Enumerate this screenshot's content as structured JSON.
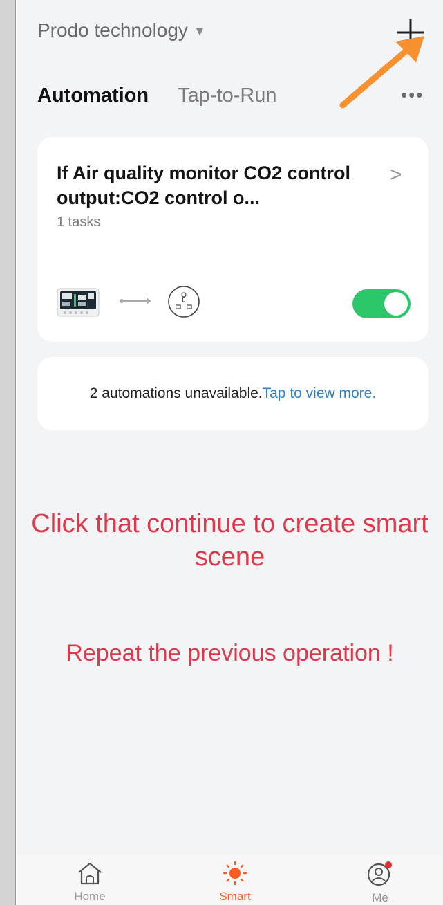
{
  "header": {
    "home_name": "Prodo technology",
    "caret_icon": "caret-down-icon",
    "add_icon": "plus-icon"
  },
  "tabs": [
    {
      "label": "Automation",
      "active": true
    },
    {
      "label": "Tap-to-Run",
      "active": false
    }
  ],
  "more_icon": "more-dots-icon",
  "automation": {
    "title": "If Air quality monitor CO2 control output:CO2 control o...",
    "tasks": "1 tasks",
    "enabled": true,
    "accent_color": "#2cc76b"
  },
  "unavailable": {
    "text": "2 automations unavailable.",
    "link": "Tap to view more."
  },
  "instructions": {
    "line1": "Click that continue to create smart scene",
    "line2": "Repeat the previous operation !",
    "color": "#e0384a"
  },
  "annotation_arrow_color": "#f7902f",
  "tabbar": {
    "items": [
      {
        "label": "Home",
        "icon": "home-icon",
        "active": false
      },
      {
        "label": "Smart",
        "icon": "sun-icon",
        "active": true
      },
      {
        "label": "Me",
        "icon": "user-icon",
        "active": false,
        "badge": true
      }
    ],
    "active_color": "#ff5a1f"
  }
}
